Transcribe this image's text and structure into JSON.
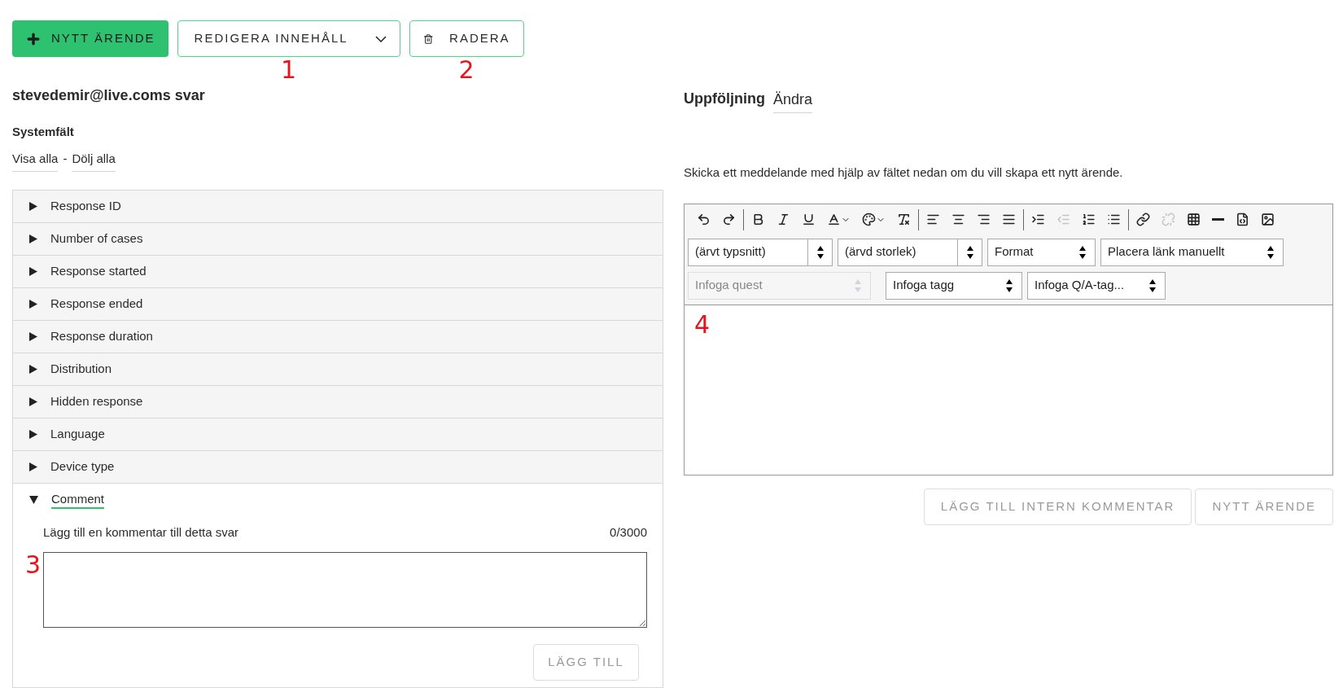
{
  "actions": [
    {
      "kind": "add",
      "label": "NYTT ÄRENDE"
    },
    {
      "kind": "dropdown",
      "label": "REDIGERA INNEHÅLL",
      "marker": "1"
    },
    {
      "kind": "delete",
      "label": "RADERA",
      "marker": "2"
    }
  ],
  "left": {
    "title": "stevedemir@live.coms svar",
    "section": "Systemfält",
    "links": [
      "Visa alla",
      "Dölj alla"
    ],
    "separator": "-",
    "fields": [
      {
        "label": "Response ID",
        "expanded": false
      },
      {
        "label": "Number of cases",
        "expanded": false
      },
      {
        "label": "Response started",
        "expanded": false
      },
      {
        "label": "Response ended",
        "expanded": false
      },
      {
        "label": "Response duration",
        "expanded": false
      },
      {
        "label": "Distribution",
        "expanded": false
      },
      {
        "label": "Hidden response",
        "expanded": false
      },
      {
        "label": "Language",
        "expanded": false
      },
      {
        "label": "Device type",
        "expanded": false
      },
      {
        "label": "Comment",
        "expanded": true
      }
    ],
    "comment": {
      "label": "Lägg till en kommentar till detta svar",
      "counter": "0/3000",
      "marker": "3",
      "button": "LÄGG TILL",
      "button_disabled": true
    }
  },
  "right": {
    "title": "Uppföljning",
    "edit_link": "Ändra",
    "info": "Skicka ett meddelande med hjälp av fältet nedan om du vill skapa ett nytt ärende.",
    "toolbar": [
      [
        {
          "kind": "undo",
          "disabled": false
        },
        {
          "kind": "redo",
          "disabled": false
        }
      ],
      [
        {
          "kind": "bold",
          "disabled": false
        },
        {
          "kind": "italic",
          "disabled": false
        },
        {
          "kind": "underline",
          "disabled": false
        },
        {
          "kind": "text-color",
          "disabled": false
        },
        {
          "kind": "bg-color",
          "disabled": false
        },
        {
          "kind": "clear-format",
          "disabled": false
        }
      ],
      [
        {
          "kind": "align-left",
          "disabled": false
        },
        {
          "kind": "align-center",
          "disabled": false
        },
        {
          "kind": "align-right",
          "disabled": false
        },
        {
          "kind": "align-justify",
          "disabled": false
        }
      ],
      [
        {
          "kind": "indent",
          "disabled": false
        },
        {
          "kind": "outdent",
          "disabled": true
        },
        {
          "kind": "ordered-list",
          "disabled": false
        },
        {
          "kind": "bullet-list",
          "disabled": false
        }
      ],
      [
        {
          "kind": "link",
          "disabled": false
        },
        {
          "kind": "unlink",
          "disabled": true
        },
        {
          "kind": "table",
          "disabled": false
        },
        {
          "kind": "rule",
          "disabled": false
        },
        {
          "kind": "source",
          "disabled": false
        },
        {
          "kind": "image",
          "disabled": false
        }
      ]
    ],
    "selects": [
      [
        {
          "value": "(ärvt typsnitt)",
          "disabled": false,
          "framed": true
        },
        {
          "value": "(ärvd storlek)",
          "disabled": false,
          "framed": true
        },
        {
          "value": "Format",
          "disabled": false,
          "framed": false
        },
        {
          "value": "Placera länk manuellt",
          "disabled": false,
          "framed": false
        }
      ],
      [
        {
          "value": "Infoga quest",
          "disabled": true,
          "framed": false
        },
        {
          "value": "Infoga tagg",
          "disabled": false,
          "framed": false
        },
        {
          "value": "Infoga Q/A-tag...",
          "disabled": false,
          "framed": false
        }
      ]
    ],
    "editor_marker": "4",
    "buttons": [
      {
        "label": "LÄGG TILL INTERN KOMMENTAR",
        "disabled": true
      },
      {
        "label": "NYTT ÄRENDE",
        "disabled": true
      }
    ]
  }
}
